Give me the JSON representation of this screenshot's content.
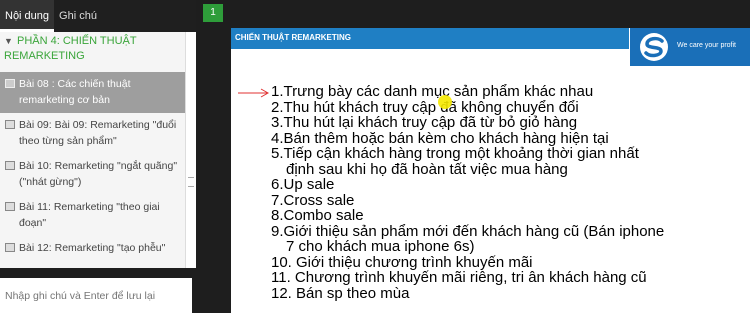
{
  "tabs": {
    "content": "Nội dung",
    "notes": "Ghi chú"
  },
  "section": {
    "title": "PHẦN 4: CHIẾN THUẬT REMARKETING"
  },
  "lessons": [
    {
      "label": "Bài 08 : Các chiến thuật remarketing cơ bản",
      "active": true
    },
    {
      "label": "Bài 09: Bài 09: Remarketing \"đuổi theo từng sản phẩm\""
    },
    {
      "label": "Bài 10: Remarketing \"ngắt quãng\" (\"nhát gừng\")"
    },
    {
      "label": "Bài 11: Remarketing \"theo giai đoạn\""
    },
    {
      "label": "Bài 12: Remarketing \"tạo phễu\""
    }
  ],
  "note": {
    "placeholder": "Nhập ghi chú và Enter để lưu lại"
  },
  "page_indicator": "1",
  "slide": {
    "header_title": "CHIẾN THUẬT REMARKETING",
    "logo_tagline": "We care your profit",
    "items": [
      {
        "text": "1.Trưng bày các danh mục sản phẩm khác nhau"
      },
      {
        "text": "2.Thu hút khách truy cập đã không chuyển đổi"
      },
      {
        "text": "3.Thu hút lại khách truy cập đã từ bỏ giỏ hàng"
      },
      {
        "text": "4.Bán thêm hoặc bán kèm cho khách hàng hiện tại"
      },
      {
        "text": "5.Tiếp cận khách hàng trong một khoảng thời gian nhất",
        "cont": "định sau khi họ đã hoàn tất việc mua hàng"
      },
      {
        "text": "6.Up sale"
      },
      {
        "text": "7.Cross sale"
      },
      {
        "text": "8.Combo sale"
      },
      {
        "text": "9.Giới thiệu sản phẩm mới đến khách hàng cũ (Bán iphone",
        "cont": "7 cho khách mua iphone 6s)"
      },
      {
        "text": "10. Giới thiệu chương trình khuyến mãi"
      },
      {
        "text": "11. Chương trình khuyến mãi riêng, tri ân khách hàng cũ"
      },
      {
        "text": "12. Bán sp theo mùa"
      }
    ]
  },
  "colors": {
    "section_green": "#3aa53a",
    "active_lesson": "#9e9e9e",
    "header_blue": "#1f7fc4",
    "arrow_red": "#e03030",
    "page_green": "#2e9d3a"
  }
}
